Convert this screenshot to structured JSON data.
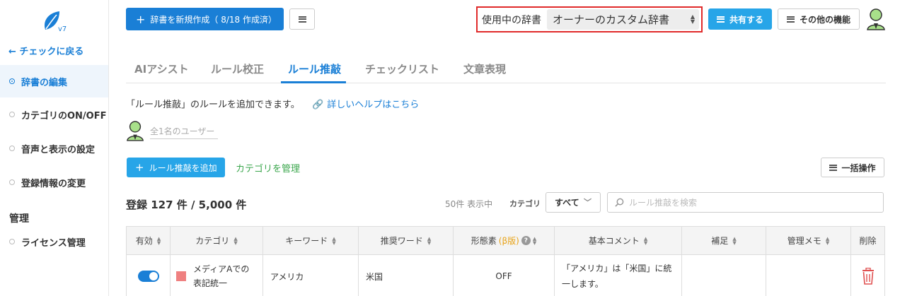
{
  "sidebar": {
    "version": "v7",
    "back_label": "← チェックに戻る",
    "items": [
      {
        "label": "辞書の編集",
        "active": true
      },
      {
        "label": "カテゴリのON/OFF",
        "active": false
      },
      {
        "label": "音声と表示の設定",
        "active": false
      },
      {
        "label": "登録情報の変更",
        "active": false
      }
    ],
    "admin_section_label": "管理",
    "admin_items": [
      {
        "label": "ライセンス管理"
      }
    ]
  },
  "toolbar": {
    "new_dict_label": "辞書を新規作成（ 8/18 作成済）",
    "dict_in_use_label": "使用中の辞書",
    "dict_selected": "オーナーのカスタム辞書",
    "share_label": "共有する",
    "more_label": "その他の機能"
  },
  "tabs": [
    {
      "label": "AIアシスト"
    },
    {
      "label": "ルール校正"
    },
    {
      "label": "ルール推敲",
      "active": true
    },
    {
      "label": "チェックリスト"
    },
    {
      "label": "文章表現"
    }
  ],
  "content": {
    "description": "「ルール推敲」のルールを追加できます。",
    "help_link": "詳しいヘルプはこちら",
    "users_placeholder": "全1名のユーザー",
    "add_rule_label": "ルール推敲を追加",
    "manage_category_label": "カテゴリを管理",
    "bulk_label": "一括操作",
    "count_title": "登録 127 件 / 5,000 件",
    "showing_label": "50件 表示中",
    "category_filter_label": "カテゴリ",
    "category_filter_value": "すべて",
    "search_placeholder": "ルール推敲を検索"
  },
  "table": {
    "headers": {
      "enabled": "有効",
      "category": "カテゴリ",
      "keyword": "キーワード",
      "suggestion": "推奨ワード",
      "morpheme": "形態素",
      "morpheme_beta": "(β版)",
      "comment": "基本コメント",
      "supplement": "補足",
      "memo": "管理メモ",
      "delete": "削除"
    },
    "rows": [
      {
        "enabled": true,
        "category": "メディアAでの表記統一",
        "category_color": "#ef8080",
        "keyword": "アメリカ",
        "suggestion": "米国",
        "morpheme": "OFF",
        "comment": "「アメリカ」は「米国」に統一します。",
        "supplement": "",
        "memo": ""
      }
    ]
  },
  "colors": {
    "primary": "#1a7fd6",
    "accent": "#27a5e8",
    "highlight_border": "#e02a2a",
    "link_green": "#3aa64c",
    "delete_red": "#e05050"
  }
}
